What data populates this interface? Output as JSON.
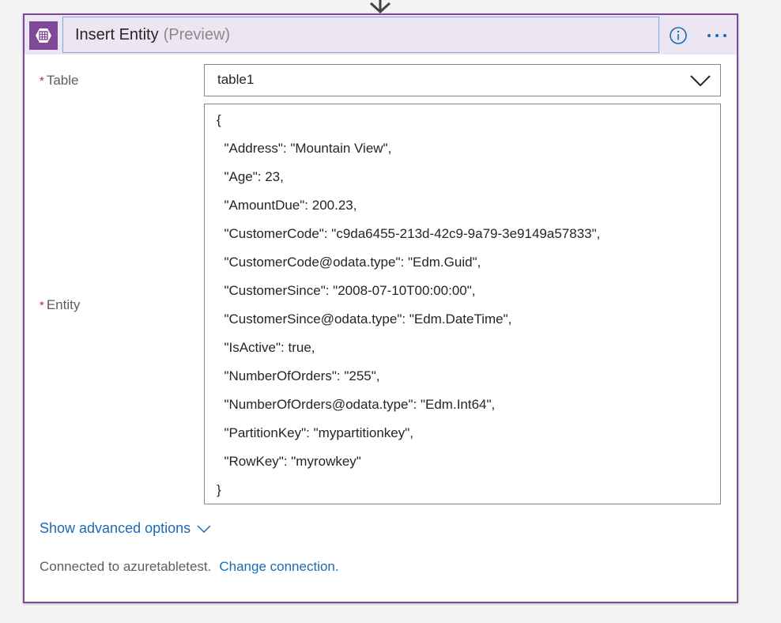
{
  "header": {
    "title": "Insert Entity",
    "preview_label": "(Preview)",
    "icon": "table-grid-icon",
    "accent_color": "#804998"
  },
  "fields": {
    "table": {
      "label": "Table",
      "required_mark": "*",
      "value": "table1"
    },
    "entity": {
      "label": "Entity",
      "required_mark": "*",
      "lines": [
        "{",
        "  \"Address\": \"Mountain View\",",
        "  \"Age\": 23,",
        "  \"AmountDue\": 200.23,",
        "  \"CustomerCode\": \"c9da6455-213d-42c9-9a79-3e9149a57833\",",
        "  \"CustomerCode@odata.type\": \"Edm.Guid\",",
        "  \"CustomerSince\": \"2008-07-10T00:00:00\",",
        "  \"CustomerSince@odata.type\": \"Edm.DateTime\",",
        "  \"IsActive\": true,",
        "  \"NumberOfOrders\": \"255\",",
        "  \"NumberOfOrders@odata.type\": \"Edm.Int64\",",
        "  \"PartitionKey\": \"mypartitionkey\",",
        "  \"RowKey\": \"myrowkey\"",
        "}"
      ]
    }
  },
  "advanced": {
    "label": "Show advanced options"
  },
  "connection": {
    "text": "Connected to azuretabletest.",
    "change_label": "Change connection."
  }
}
